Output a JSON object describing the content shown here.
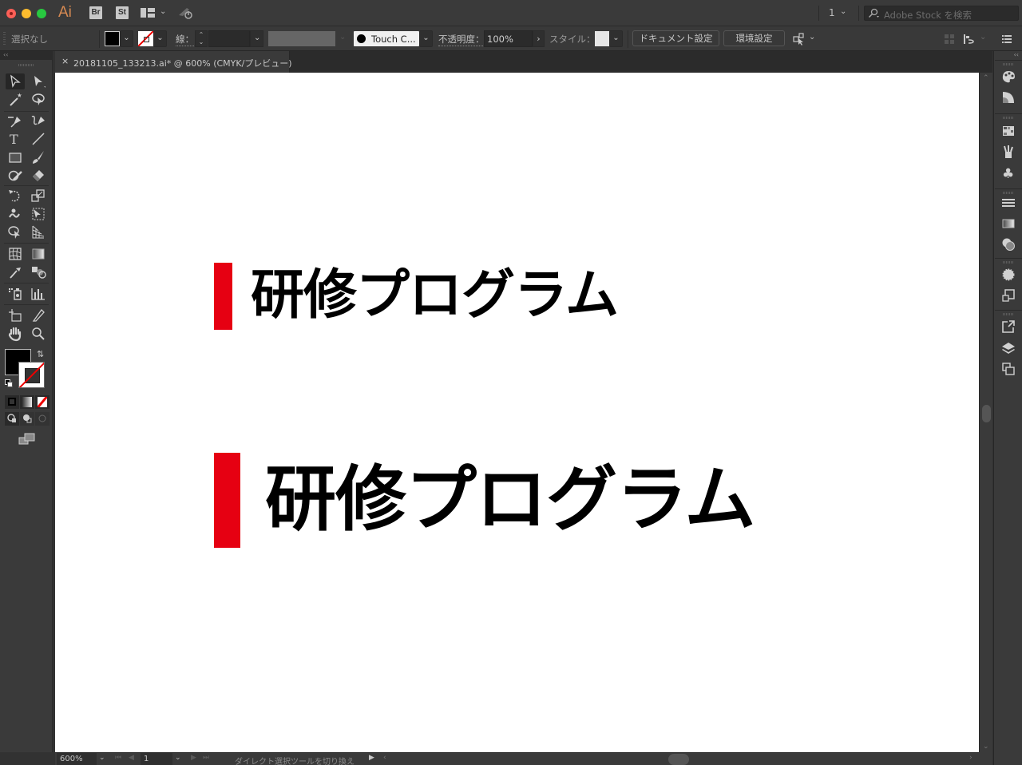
{
  "titlebar": {
    "app_logo": "Ai",
    "bridge_label": "Br",
    "stock_label": "St",
    "workspace_icon": "workspace-layout-icon",
    "sync_icon": "sync-icon",
    "page_value": "1",
    "search_placeholder": "Adobe Stock を検索"
  },
  "controlbar": {
    "selection_status": "選択なし",
    "fill_color": "#000000",
    "stroke_color": "none",
    "stroke_label": "線：",
    "stroke_weight": "",
    "brush_label": "Touch C...",
    "opacity_label": "不透明度：",
    "opacity_value": "100%",
    "style_label": "スタイル：",
    "document_setup_label": "ドキュメント設定",
    "preferences_label": "環境設定"
  },
  "tab": {
    "close_label": "×",
    "title": "20181105_133213.ai* @ 600% (CMYK/プレビュー)"
  },
  "canvas": {
    "accent_color": "#e60012",
    "headings": [
      {
        "text": "研修プログラム"
      },
      {
        "text": "研修プログラム"
      }
    ]
  },
  "statusbar": {
    "zoom_value": "600%",
    "artboard_value": "1",
    "status_text": "ダイレクト選択ツールを切り換え"
  },
  "tools": [
    "selection-tool",
    "direct-selection-tool",
    "magic-wand-tool",
    "lasso-tool",
    "pen-tool",
    "curvature-tool",
    "type-tool",
    "line-segment-tool",
    "rectangle-tool",
    "paintbrush-tool",
    "shaper-tool",
    "eraser-tool",
    "rotate-tool",
    "scale-tool",
    "warp-tool",
    "free-transform-tool",
    "shape-builder-tool",
    "perspective-grid-tool",
    "mesh-tool",
    "gradient-tool",
    "eyedropper-tool",
    "blend-tool",
    "symbol-sprayer-tool",
    "column-graph-tool",
    "artboard-tool",
    "slice-tool",
    "hand-tool",
    "zoom-tool"
  ],
  "right_panels": [
    "color-panel",
    "color-guide-panel",
    "swatches-panel",
    "brushes-panel",
    "symbols-panel",
    "stroke-panel",
    "gradient-panel",
    "transparency-panel",
    "appearance-panel",
    "graphic-styles-panel",
    "export-panel",
    "layers-panel",
    "artboards-panel"
  ]
}
